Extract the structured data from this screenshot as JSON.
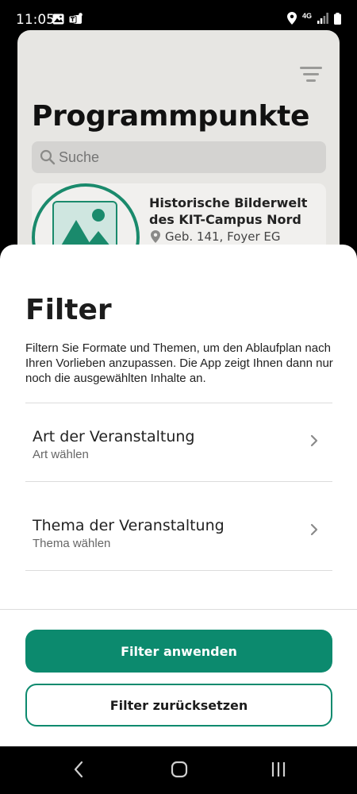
{
  "status": {
    "time": "11:05",
    "network": "4G"
  },
  "background": {
    "title": "Programmpunkte",
    "search_placeholder": "Suche",
    "event": {
      "title": "Historische Bilderwelt des KIT-Campus Nord",
      "location": "Geb. 141, Foyer EG"
    }
  },
  "sheet": {
    "title": "Filter",
    "description": "Filtern Sie Formate und Themen, um den Ablaufplan nach Ihren Vorlieben anzupassen. Die App zeigt Ihnen dann nur noch die ausgewählten Inhalte an.",
    "rows": [
      {
        "title": "Art der Veranstaltung",
        "subtitle": "Art wählen"
      },
      {
        "title": "Thema der Veranstaltung",
        "subtitle": "Thema wählen"
      }
    ],
    "apply_label": "Filter anwenden",
    "reset_label": "Filter zurücksetzen"
  },
  "colors": {
    "accent": "#0c8a6e",
    "background_card": "#e7e6e3"
  },
  "icons": [
    "gallery-icon",
    "teams-icon",
    "location-icon",
    "signal-icon",
    "battery-icon",
    "filter-icon",
    "search-icon",
    "image-placeholder-icon",
    "map-pin-icon",
    "chevron-right-icon",
    "nav-back-icon",
    "nav-home-icon",
    "nav-recents-icon"
  ]
}
